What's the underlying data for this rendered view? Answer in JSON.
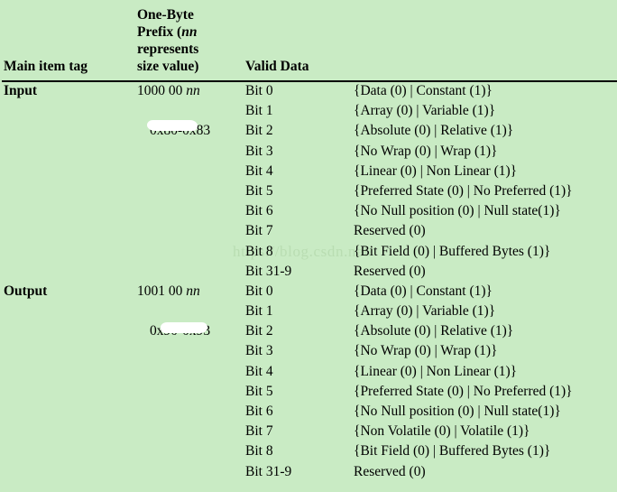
{
  "table": {
    "headers": {
      "main_item_tag": "Main item tag",
      "one_byte_prefix_line1": "One-Byte",
      "one_byte_prefix_line2_pre": "Prefix (",
      "one_byte_prefix_line2_italic": "nn",
      "one_byte_prefix_line3": "represents",
      "one_byte_prefix_line4": "size value)",
      "valid_data": "Valid Data"
    },
    "groups": [
      {
        "tag": "Input",
        "prefix_bits": "1000 00",
        "prefix_italic": "nn",
        "prefix_hex": "0x80-0x83",
        "rows": [
          {
            "bit": "Bit 0",
            "value": "{Data (0) | Constant (1)}"
          },
          {
            "bit": "Bit 1",
            "value": "{Array (0) | Variable (1)}"
          },
          {
            "bit": "Bit 2",
            "value": "{Absolute (0) | Relative (1)}"
          },
          {
            "bit": "Bit 3",
            "value": "{No Wrap (0) | Wrap (1)}"
          },
          {
            "bit": "Bit 4",
            "value": "{Linear (0) | Non Linear (1)}"
          },
          {
            "bit": "Bit 5",
            "value": "{Preferred State (0) | No Preferred (1)}"
          },
          {
            "bit": "Bit 6",
            "value": "{No Null position (0) | Null state(1)}"
          },
          {
            "bit": "Bit 7",
            "value": "Reserved (0)"
          },
          {
            "bit": "Bit 8",
            "value": "{Bit Field (0) | Buffered Bytes (1)}"
          },
          {
            "bit": "Bit 31-9",
            "value": "Reserved (0)"
          }
        ]
      },
      {
        "tag": "Output",
        "prefix_bits": "1001 00",
        "prefix_italic": "nn",
        "prefix_hex": "0x90-0x93",
        "rows": [
          {
            "bit": "Bit 0",
            "value": "{Data (0) | Constant (1)}"
          },
          {
            "bit": "Bit 1",
            "value": "{Array (0) | Variable (1)}"
          },
          {
            "bit": "Bit 2",
            "value": "{Absolute (0) | Relative (1)}"
          },
          {
            "bit": "Bit 3",
            "value": "{No Wrap (0) | Wrap (1)}"
          },
          {
            "bit": "Bit 4",
            "value": "{Linear (0) | Non Linear (1)}"
          },
          {
            "bit": "Bit 5",
            "value": "{Preferred State (0) | No Preferred (1)}"
          },
          {
            "bit": "Bit 6",
            "value": "{No Null position (0) | Null state(1)}"
          },
          {
            "bit": "Bit 7",
            "value": "{Non Volatile (0) | Volatile (1)}"
          },
          {
            "bit": "Bit 8",
            "value": "{Bit Field (0) | Buffered Bytes (1)}"
          },
          {
            "bit": "Bit 31-9",
            "value": "Reserved (0)"
          }
        ]
      }
    ]
  },
  "watermark": {
    "text": "https://blog.csdn.net/"
  },
  "colors": {
    "background": "#c9ebc4",
    "text": "#000000",
    "rule": "#000000",
    "watermark": "#b9ddb2",
    "redaction": "#ffffff"
  }
}
